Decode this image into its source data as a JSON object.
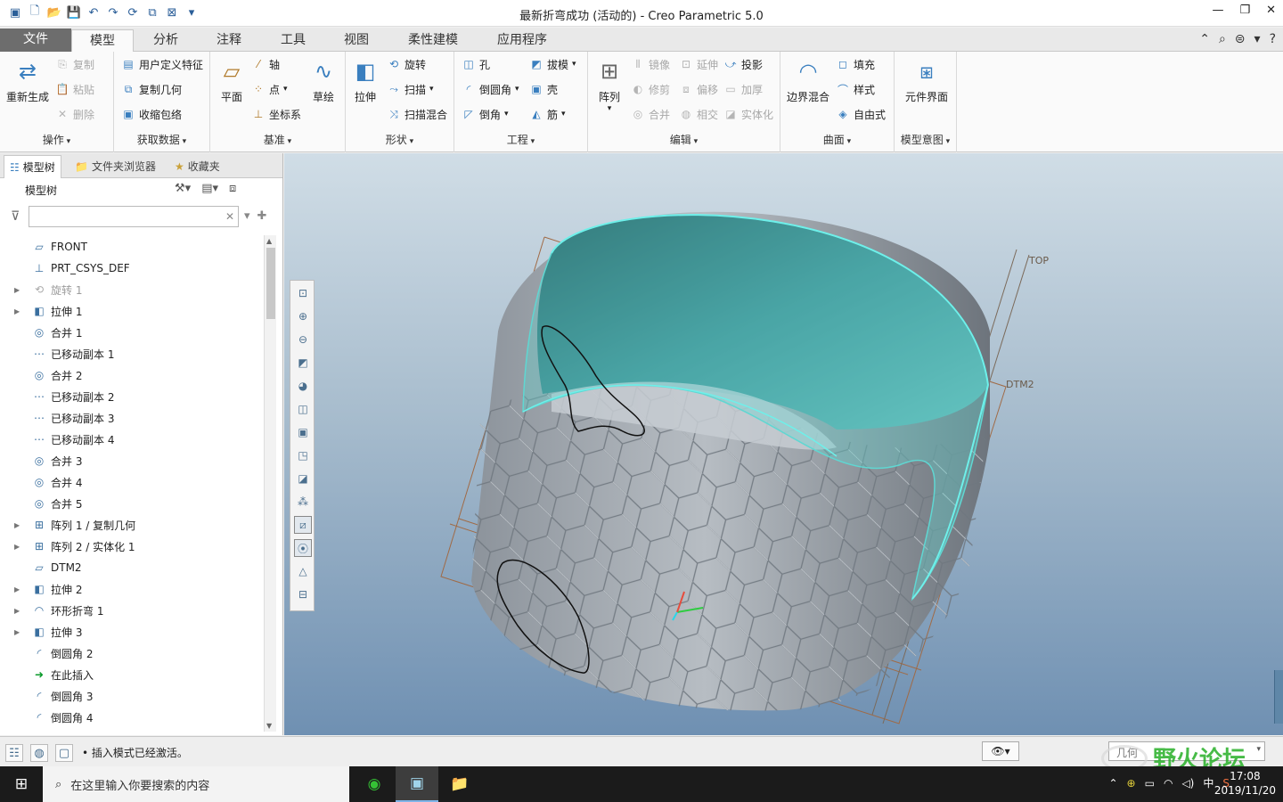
{
  "window": {
    "title": "最新折弯成功 (活动的) - Creo Parametric 5.0",
    "controls": [
      "—",
      "❐",
      "✕"
    ]
  },
  "tabs": [
    "文件",
    "模型",
    "分析",
    "注释",
    "工具",
    "视图",
    "柔性建模",
    "应用程序"
  ],
  "active_tab": "模型",
  "ribbon": {
    "ops": {
      "regen": "重新生成",
      "copy": "复制",
      "paste": "粘贴",
      "delete": "删除",
      "label": "操作"
    },
    "getdata": {
      "udf": "用户定义特征",
      "copygeom": "复制几何",
      "shrinkwrap": "收缩包络",
      "label": "获取数据"
    },
    "datum": {
      "plane": "平面",
      "axis": "轴",
      "point": "点",
      "csys": "坐标系",
      "sketch": "草绘",
      "label": "基准"
    },
    "shapes": {
      "extrude": "拉伸",
      "revolve": "旋转",
      "sweep": "扫描",
      "sweepblend": "扫描混合",
      "label": "形状"
    },
    "eng": {
      "hole": "孔",
      "round": "倒圆角",
      "chamfer": "倒角",
      "draft": "拔模",
      "shell": "壳",
      "rib": "筋",
      "label": "工程"
    },
    "edit": {
      "pattern": "阵列",
      "mirror": "镜像",
      "extend": "延伸",
      "project": "投影",
      "trim": "修剪",
      "offset": "偏移",
      "thicken": "加厚",
      "merge": "合并",
      "intersect": "相交",
      "solidify": "实体化",
      "label": "编辑"
    },
    "surfaces": {
      "boundary": "边界混合",
      "fill": "填充",
      "style": "样式",
      "freestyle": "自由式",
      "label": "曲面"
    },
    "intent": {
      "component": "元件界面",
      "label": "模型意图"
    }
  },
  "panel": {
    "tabs": [
      "模型树",
      "文件夹浏览器",
      "收藏夹"
    ],
    "header": "模型树",
    "search_value": "",
    "tree": [
      {
        "label": "FRONT",
        "icon": "datum-plane-icon",
        "expandable": false,
        "state": "normal"
      },
      {
        "label": "PRT_CSYS_DEF",
        "icon": "csys-icon",
        "expandable": false,
        "state": "normal"
      },
      {
        "label": "旋转 1",
        "icon": "revolve-icon",
        "expandable": true,
        "state": "suppressed"
      },
      {
        "label": "拉伸 1",
        "icon": "extrude-icon",
        "expandable": true,
        "state": "normal"
      },
      {
        "label": "合并 1",
        "icon": "merge-icon",
        "expandable": false,
        "state": "normal"
      },
      {
        "label": "已移动副本 1",
        "icon": "moved-copy-icon",
        "expandable": false,
        "state": "normal"
      },
      {
        "label": "合并 2",
        "icon": "merge-icon",
        "expandable": false,
        "state": "normal"
      },
      {
        "label": "已移动副本 2",
        "icon": "moved-copy-icon",
        "expandable": false,
        "state": "normal"
      },
      {
        "label": "已移动副本 3",
        "icon": "moved-copy-icon",
        "expandable": false,
        "state": "normal"
      },
      {
        "label": "已移动副本 4",
        "icon": "moved-copy-icon",
        "expandable": false,
        "state": "normal"
      },
      {
        "label": "合并 3",
        "icon": "merge-icon",
        "expandable": false,
        "state": "normal"
      },
      {
        "label": "合并 4",
        "icon": "merge-icon",
        "expandable": false,
        "state": "normal"
      },
      {
        "label": "合并 5",
        "icon": "merge-icon",
        "expandable": false,
        "state": "normal"
      },
      {
        "label": "阵列 1 / 复制几何",
        "icon": "pattern-icon",
        "expandable": true,
        "state": "normal"
      },
      {
        "label": "阵列 2 / 实体化 1",
        "icon": "pattern-icon",
        "expandable": true,
        "state": "normal"
      },
      {
        "label": "DTM2",
        "icon": "datum-plane-icon",
        "expandable": false,
        "state": "normal"
      },
      {
        "label": "拉伸 2",
        "icon": "extrude-icon",
        "expandable": true,
        "state": "normal"
      },
      {
        "label": "环形折弯 1",
        "icon": "toroidal-bend-icon",
        "expandable": true,
        "state": "normal"
      },
      {
        "label": "拉伸 3",
        "icon": "extrude-icon",
        "expandable": true,
        "state": "normal"
      },
      {
        "label": "倒圆角 2",
        "icon": "round-icon",
        "expandable": false,
        "state": "normal"
      },
      {
        "label": "在此插入",
        "icon": "insert-here-arrow-icon",
        "expandable": false,
        "state": "insert"
      },
      {
        "label": "倒圆角 3",
        "icon": "round-icon",
        "expandable": false,
        "state": "after-insert"
      },
      {
        "label": "倒圆角 4",
        "icon": "round-icon",
        "expandable": false,
        "state": "after-insert"
      }
    ]
  },
  "viewport": {
    "datum_labels": {
      "top": "TOP",
      "dtm2": "DTM2"
    },
    "colors": {
      "surface_cyan": "#5fd7d2",
      "datum_orange": "#b46a33",
      "bg_top": "#d0dde6",
      "bg_bottom": "#6f90b2"
    },
    "toolbar_icons": [
      "refit-icon",
      "zoom-in-icon",
      "zoom-out-icon",
      "repaint-icon",
      "shading-icon",
      "saved-views-icon",
      "view-manager-icon",
      "perspective-icon",
      "section-icon",
      "datum-display-icon",
      "plane-display-icon",
      "point-display-icon",
      "csys-display-icon",
      "annotation-display-icon"
    ]
  },
  "status": {
    "message": "插入模式已经激活。",
    "filter": "几何"
  },
  "taskbar": {
    "search_placeholder": "在这里输入你要搜索的内容",
    "ime": "中",
    "time": "17:08",
    "date": "2019/11/20"
  },
  "watermark": "野火论坛"
}
